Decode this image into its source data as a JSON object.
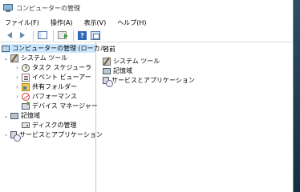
{
  "window": {
    "title": "コンピューターの管理"
  },
  "menubar": {
    "items": [
      {
        "label": "ファイル(F)"
      },
      {
        "label": "操作(A)"
      },
      {
        "label": "表示(V)"
      },
      {
        "label": "ヘルプ(H)"
      }
    ]
  },
  "toolbar": {
    "icons": [
      "back-icon",
      "forward-icon",
      "show-hide-tree-icon",
      "export-list-icon",
      "help-icon",
      "properties-icon"
    ],
    "help_glyph": "?"
  },
  "tree": {
    "root": {
      "label": "コンピューターの管理 (ローカル)",
      "icon": "computer-management-icon",
      "selected": true
    },
    "system_tools": {
      "label": "システム ツール",
      "icon": "tools-icon",
      "expanded": true
    },
    "task_scheduler": {
      "label": "タスク スケジューラ",
      "icon": "clock-icon"
    },
    "event_viewer": {
      "label": "イベント ビューアー",
      "icon": "event-viewer-icon"
    },
    "shared_folders": {
      "label": "共有フォルダー",
      "icon": "shared-folder-icon"
    },
    "performance": {
      "label": "パフォーマンス",
      "icon": "performance-icon"
    },
    "device_manager": {
      "label": "デバイス マネージャー",
      "icon": "device-manager-icon"
    },
    "storage": {
      "label": "記憶域",
      "icon": "storage-icon",
      "expanded": true
    },
    "disk_management": {
      "label": "ディスクの管理",
      "icon": "disk-icon"
    },
    "services_apps": {
      "label": "サービスとアプリケーション",
      "icon": "services-icon"
    }
  },
  "list": {
    "column_header": "名前",
    "items": [
      {
        "label": "システム ツール",
        "icon": "tools-icon"
      },
      {
        "label": "記憶域",
        "icon": "storage-icon"
      },
      {
        "label": "サービスとアプリケーション",
        "icon": "services-icon"
      }
    ]
  },
  "colors": {
    "selection": "#cce8ff",
    "desktop": "#1b3a4a"
  }
}
